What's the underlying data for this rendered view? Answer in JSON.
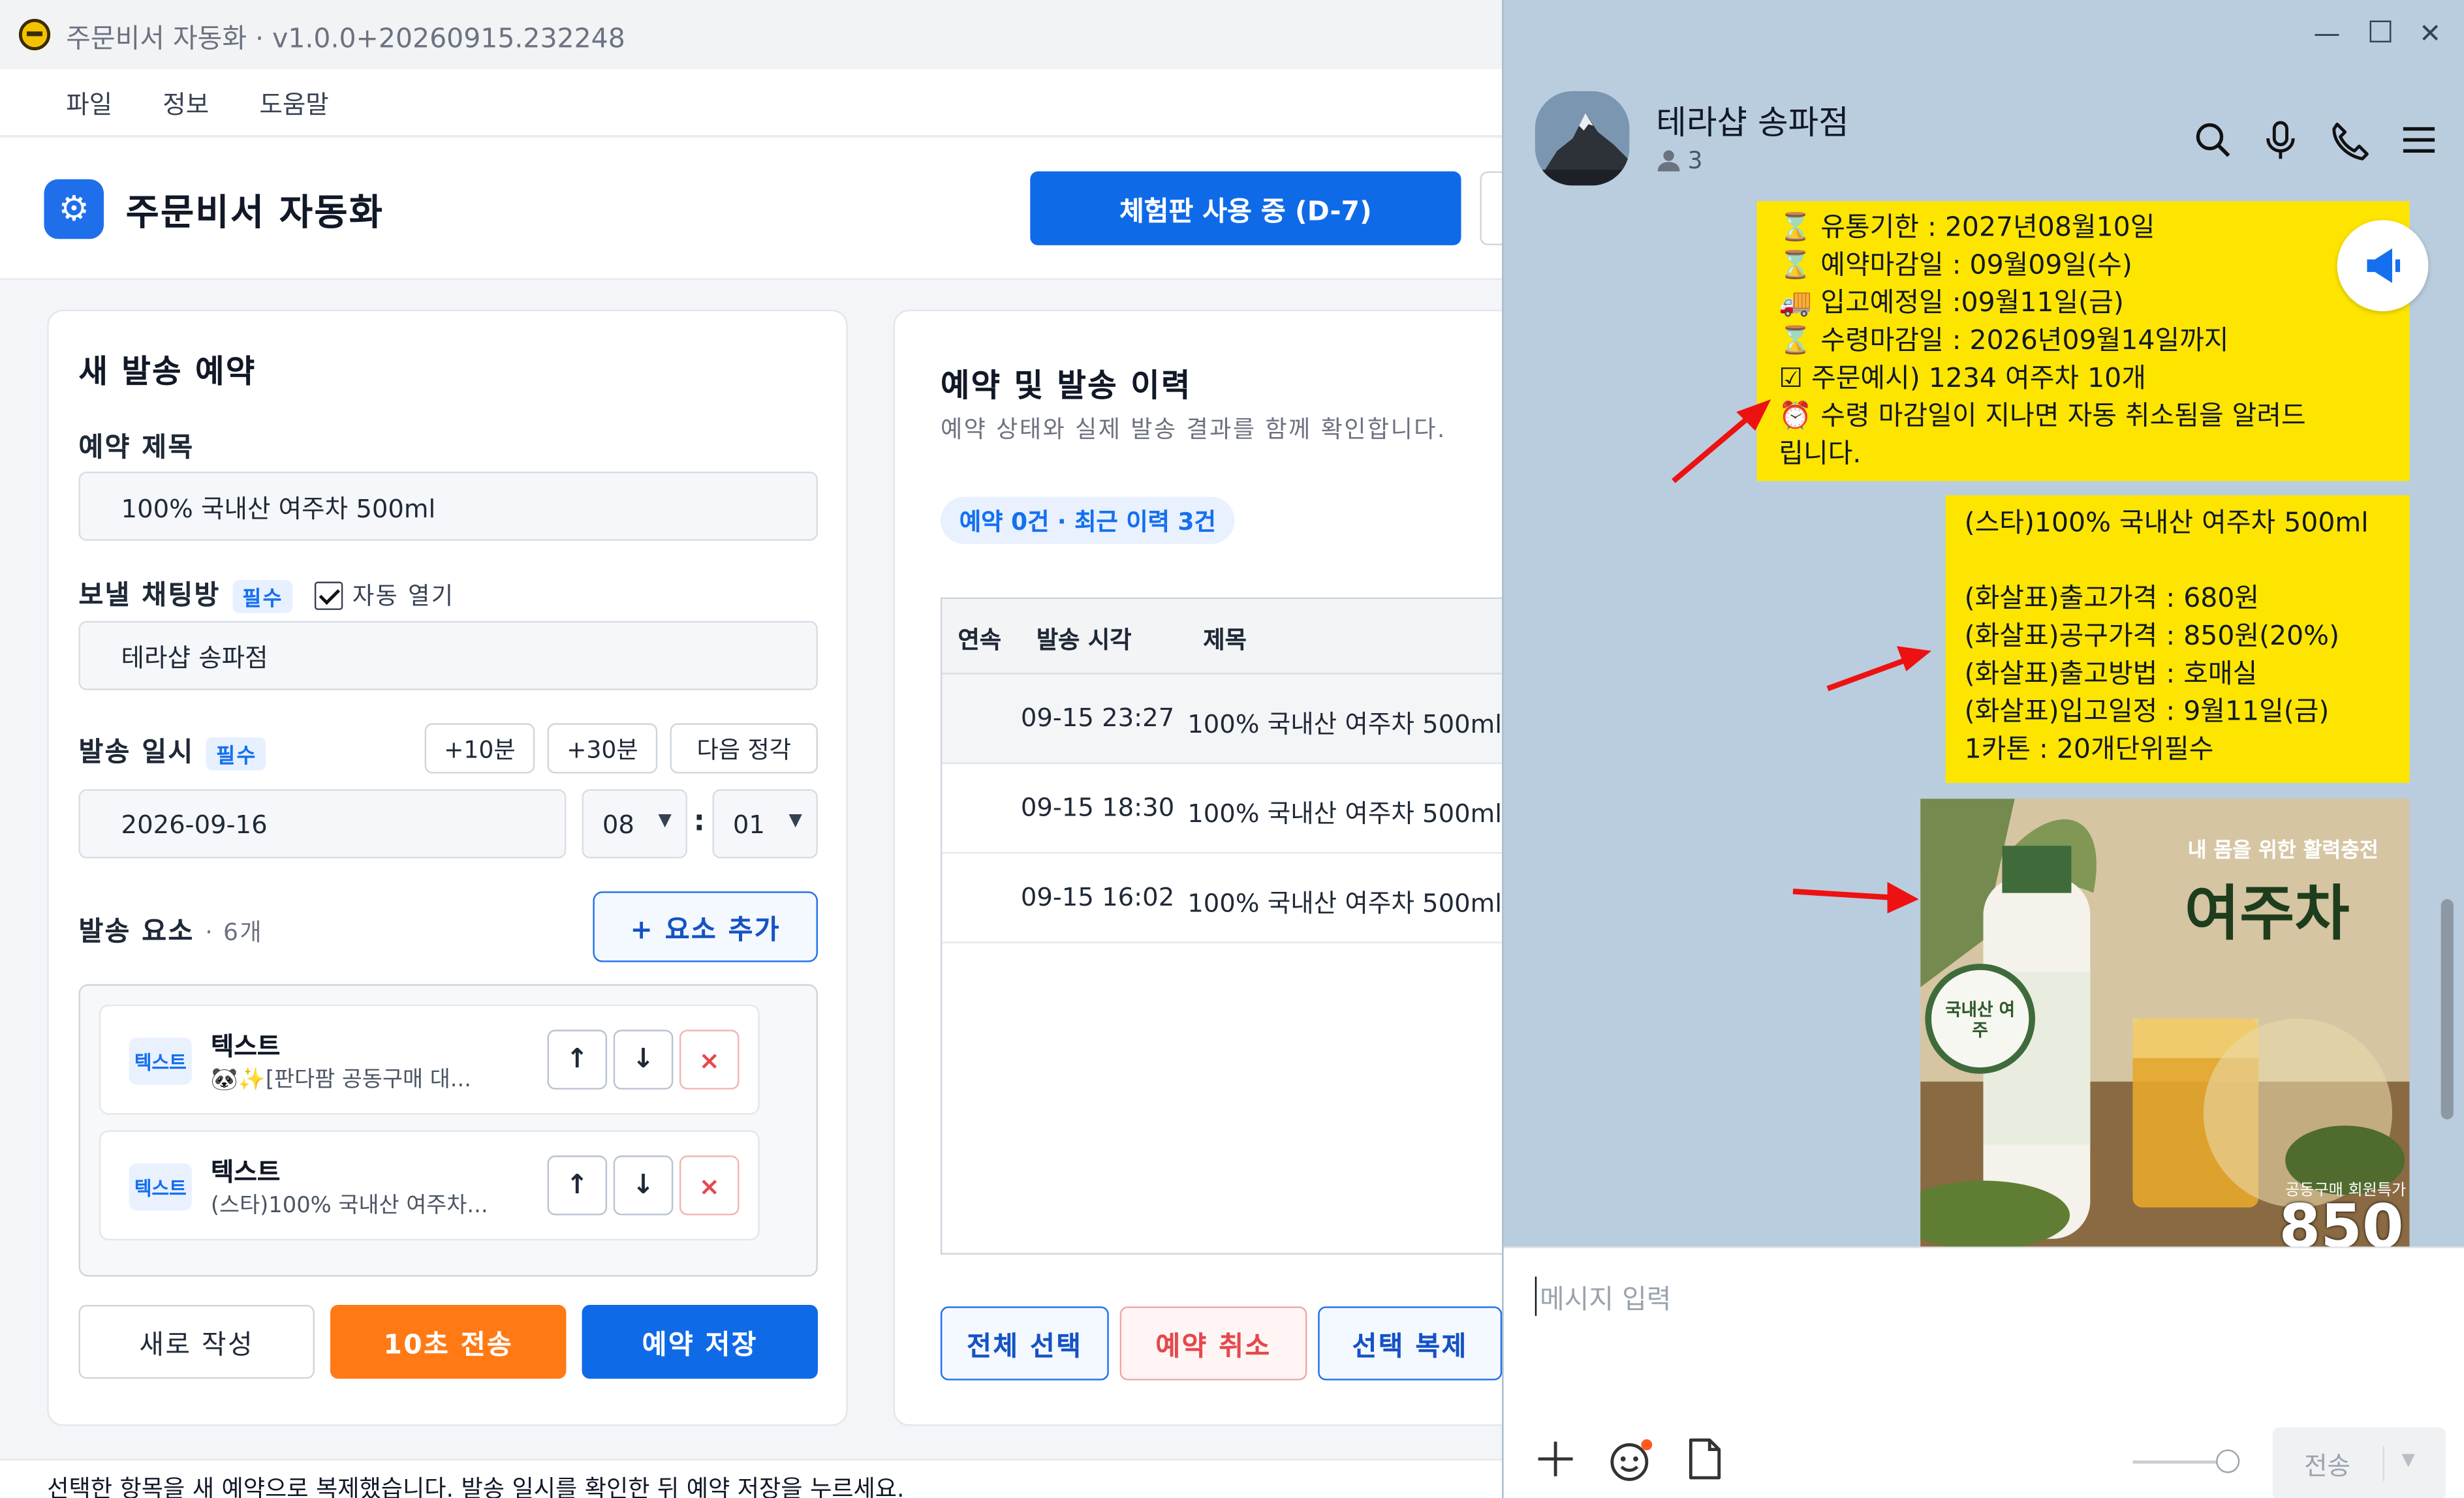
{
  "app": {
    "window_title": "주문비서 자동화 · v1.0.0+20260915.232248",
    "menu": [
      "파일",
      "정보",
      "도움말"
    ],
    "title": "주문비서 자동화",
    "trial_button": "체험판 사용 중 (D-7)"
  },
  "new_schedule": {
    "heading": "새 발송 예약",
    "title_label": "예약 제목",
    "title_value": "100% 국내산 여주차 500ml",
    "room_label": "보낼 채팅방",
    "required_badge": "필수",
    "auto_open_label": "자동 열기",
    "room_value": "테라샵 송파점",
    "datetime_label": "발송 일시",
    "quick_buttons": [
      "+10분",
      "+30분",
      "다음 정각"
    ],
    "date_value": "2026-09-16",
    "hour_value": "08",
    "colon": ":",
    "minute_value": "01",
    "elements_label": "발송 요소",
    "elements_count": "· 6개",
    "add_element_button": "+ 요소 추가",
    "elements": [
      {
        "tag": "텍스트",
        "title": "텍스트",
        "preview": "🐼✨[판다팜 공동구매 대..."
      },
      {
        "tag": "텍스트",
        "title": "텍스트",
        "preview": "(스타)100% 국내산 여주차..."
      }
    ],
    "move_up": "↑",
    "move_down": "↓",
    "delete": "×",
    "new_button": "새로 작성",
    "send10_button": "10초 전송",
    "save_button": "예약 저장"
  },
  "history": {
    "heading": "예약 및 발송 이력",
    "description": "예약 상태와 실제 발송 결과를 함께 확인합니다.",
    "badge": "예약 0건 · 최근 이력 3건",
    "columns": [
      "연속",
      "발송 시각",
      "제목"
    ],
    "rows": [
      {
        "time": "09-15 23:27",
        "title": "100% 국내산 여주차 500ml"
      },
      {
        "time": "09-15 18:30",
        "title": "100% 국내산 여주차 500ml"
      },
      {
        "time": "09-15 16:02",
        "title": "100% 국내산 여주차 500ml"
      }
    ],
    "select_all_button": "전체 선택",
    "cancel_button": "예약 취소",
    "duplicate_button": "선택 복제"
  },
  "status_bar": "선택한 항목을 새 예약으로 복제했습니다. 발송 일시를 확인한 뒤 예약 저장을 누르세요.",
  "chat": {
    "room_name": "테라샵 송파점",
    "member_count": "3",
    "bubble1": "⌛ 유통기한 : 2027년08월10일\n⌛ 예약마감일 : 09월09일(수)\n🚚 입고예정일 :09월11일(금)\n⌛ 수령마감일 : 2026년09월14일까지\n☑ 주문예시) 1234 여주차 10개\n⏰ 수령 마감일이 지나면 자동 취소됨을 알려드\n립니다.",
    "bubble2": "(스타)100% 국내산 여주차 500ml\n\n(화살표)출고가격 : 680원\n(화살표)공구가격 : 850원(20%)\n(화살표)출고방법 : 호매실\n(화살표)입고일정 : 9월11일(금)\n1카톤 : 20개단위필수",
    "promo_tagline": "내 몸을 위한 활력충전",
    "promo_title": "여주차",
    "promo_badge": "국내산 여주",
    "promo_sub": "공동구매 회원특가",
    "promo_price": "850",
    "input_placeholder": "메시지 입력",
    "send_button": "전송",
    "colors": {
      "bubble": "#fee500",
      "chat_bg": "#b9cddf",
      "accent_blue": "#0f6ae8",
      "accent_orange": "#ff7a14"
    }
  }
}
